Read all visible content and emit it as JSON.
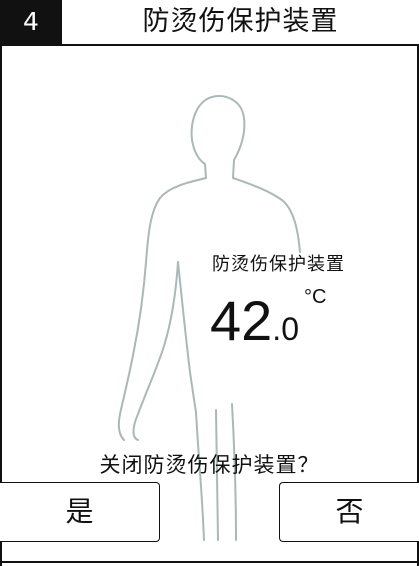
{
  "header": {
    "step_number": "4",
    "title": "防烫伤保护装置"
  },
  "temperature": {
    "label": "防烫伤保护装置",
    "integer": "42",
    "decimal": ".0",
    "unit": "°C"
  },
  "dialog": {
    "question": "关闭防烫伤保护装置？",
    "yes_label": "是",
    "no_label": "否"
  },
  "icons": {
    "figure": "human-silhouette-icon"
  },
  "colors": {
    "silhouette_stroke": "#aab8b8",
    "text": "#111111",
    "background": "#ffffff"
  }
}
